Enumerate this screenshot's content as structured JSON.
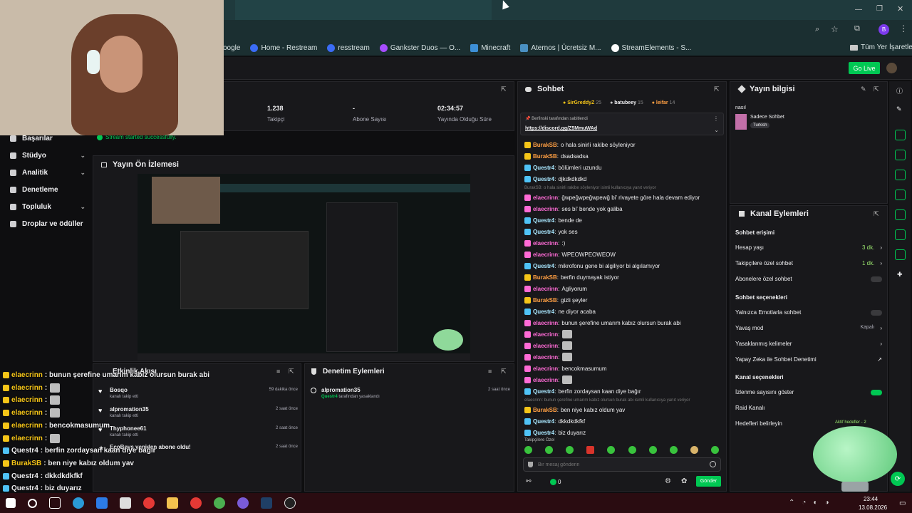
{
  "browser": {
    "bookmarks": [
      "oogle",
      "Home - Restream",
      "resstream",
      "Gankster Duos — O...",
      "Minecraft",
      "Aternos | Ücretsiz M...",
      "StreamElements - S..."
    ],
    "all_bookmarks": "Tüm Yer İşaretleri",
    "profile_initial": "B"
  },
  "header": {
    "go_live": "Go Live"
  },
  "stats": [
    {
      "value": "1.238",
      "label": "Takipçi"
    },
    {
      "value": "-",
      "label": "Abone Sayısı"
    },
    {
      "value": "02:34:57",
      "label": "Yayında Olduğu Süre"
    }
  ],
  "stream_status": "Stream started successfully.",
  "sidebar": {
    "items": [
      {
        "label": "Başarılar"
      },
      {
        "label": "Stüdyo"
      },
      {
        "label": "Analitik"
      },
      {
        "label": "Denetleme"
      },
      {
        "label": "Topluluk"
      },
      {
        "label": "Droplar ve ödüller"
      }
    ]
  },
  "preview": {
    "title": "Yayın Ön İzlemesi"
  },
  "activity": {
    "title": "Etkinlik Akışı",
    "items": [
      {
        "name": "Bosqo",
        "action": "kanalı takip etti",
        "time": "59 dakika önce"
      },
      {
        "name": "alpromation35",
        "action": "kanalı takip etti",
        "time": "2 saat önce"
      },
      {
        "name": "Thyphonee61",
        "action": "kanalı takip etti",
        "time": "2 saat önce"
      },
      {
        "name": "EcoBeys yeniden abone oldu!",
        "action": "",
        "time": "2 saat önce"
      }
    ]
  },
  "mod_actions": {
    "title": "Denetim Eylemleri",
    "items": [
      {
        "name": "alpromation35",
        "by": "Questr4",
        "action": "tarafından yasaklandı",
        "time": "2 saat önce"
      }
    ]
  },
  "chat": {
    "title": "Sohbet",
    "top_users": [
      {
        "name": "SirGreddyZ",
        "count": "25"
      },
      {
        "name": "batubeey",
        "count": "15"
      },
      {
        "name": "leifar",
        "count": "14"
      }
    ],
    "pinned_by": "Berfinski tarafından sabitlendi",
    "pinned_link": "https://discord.gg/Z5MmuWAd",
    "messages": [
      {
        "user": "BurakSB",
        "color": "o",
        "text": "o hala sinirli rakibe söyleniyor"
      },
      {
        "user": "BurakSB",
        "color": "o",
        "text": "dsadsadsa"
      },
      {
        "user": "Questr4",
        "color": "c",
        "text": "bölümleri uzundu"
      },
      {
        "user": "Questr4",
        "color": "c",
        "text": "djkdkdkdkd"
      },
      {
        "sys": "BurakSB: o hala sinirli rakibe söyleniyor isimli kullanıcıya yanıt veriyor"
      },
      {
        "user": "elaecrinn",
        "color": "p",
        "text": "ğwpeğwpeğwpewğ bi' rivayete göre hala devam ediyor"
      },
      {
        "user": "elaecrinn",
        "color": "p",
        "text": "ses bi' bende yok galiba"
      },
      {
        "user": "Questr4",
        "color": "c",
        "text": "bende de"
      },
      {
        "user": "Questr4",
        "color": "c",
        "text": "yok ses"
      },
      {
        "user": "elaecrinn",
        "color": "p",
        "text": ":)"
      },
      {
        "user": "elaecrinn",
        "color": "p",
        "text": "WPEOWPEOWEOW"
      },
      {
        "user": "Questr4",
        "color": "c",
        "text": "mikrofonu gene bi algiliyor bi algılamıyor"
      },
      {
        "user": "BurakSB",
        "color": "o",
        "text": "berfin duymayak istiyor"
      },
      {
        "user": "elaecrinn",
        "color": "p",
        "text": "Agliyorum"
      },
      {
        "user": "BurakSB",
        "color": "o",
        "text": "gizli şeyler"
      },
      {
        "user": "Questr4",
        "color": "c",
        "text": "ne diyor acaba"
      },
      {
        "user": "elaecrinn",
        "color": "p",
        "text": "bunun şerefine umarım kabız olursun burak abi"
      },
      {
        "user": "elaecrinn",
        "color": "p",
        "text": "",
        "emote": true
      },
      {
        "user": "elaecrinn",
        "color": "p",
        "text": "",
        "emote": true
      },
      {
        "user": "elaecrinn",
        "color": "p",
        "text": "",
        "emote": true
      },
      {
        "user": "elaecrinn",
        "color": "p",
        "text": "bencokmasumum"
      },
      {
        "user": "elaecrinn",
        "color": "p",
        "text": "",
        "emote": true
      },
      {
        "user": "Questr4",
        "color": "c",
        "text": "berfin zordaysan kaan diye bağır"
      },
      {
        "sys": "elaecrinn: bunun şerefine umarım kabız olursun burak abi isimli kullanıcıya yanıt veriyor"
      },
      {
        "user": "BurakSB",
        "color": "o",
        "text": "ben niye kabız oldum yav"
      },
      {
        "user": "Questr4",
        "color": "c",
        "text": "dkkdkdkfkf"
      },
      {
        "user": "Questr4",
        "color": "c",
        "text": "biz duyarız"
      }
    ],
    "followers_only": "Takipçilere Özel",
    "input_placeholder": "Bir mesaj gönderin",
    "points": "0",
    "send": "Gönder"
  },
  "stream_info": {
    "title": "Yayın bilgisi",
    "stream_title": "nasıl",
    "category": "Sadece Sohbet",
    "tag": "Turkish"
  },
  "channel_actions": {
    "title": "Kanal Eylemleri",
    "chat_access": "Sohbet erişimi",
    "account_age": "Hesap yaşı",
    "account_age_val": "3 dk.",
    "followers_chat": "Takipçilere özel sohbet",
    "followers_chat_val": "1 dk.",
    "subs_chat": "Abonelere özel sohbet",
    "chat_options": "Sohbet seçenekleri",
    "emote_only": "Yalnızca Emotlarla sohbet",
    "slow_mode": "Yavaş mod",
    "slow_mode_val": "Kapalı",
    "blocked_terms": "Yasaklanmış kelimeler",
    "ai_mod": "Yapay Zeka ile Sohbet Denetimi",
    "channel_options": "Kanal seçenekleri",
    "show_viewers": "İzlenme sayısını göster",
    "raid": "Raid Kanalı",
    "goals": "Hedefleri belirleyin",
    "active_goals": "Aktif hedefler - 2"
  },
  "overlay_chat": [
    {
      "user": "elaecrinn",
      "text": ": bunun şerefine umarım kabız olursun burak abi"
    },
    {
      "user": "elaecrinn",
      "text": ":",
      "emote": true
    },
    {
      "user": "elaecrinn",
      "text": ":",
      "emote": true
    },
    {
      "user": "elaecrinn",
      "text": ":",
      "emote": true
    },
    {
      "user": "elaecrinn",
      "text": ": bencokmasumum"
    },
    {
      "user": "elaecrinn",
      "text": ":",
      "emote": true
    },
    {
      "user": "Questr4",
      "text": ": berfin zordaysan kaan diye bağır"
    },
    {
      "user": "BurakSB",
      "text": ": ben niye kabız oldum yav"
    },
    {
      "user": "Questr4",
      "text": ": dkkdkdkfkf"
    },
    {
      "user": "Questr4",
      "text": ": biz duyarız"
    }
  ],
  "taskbar": {
    "time": "23:44",
    "date": "13.08.2026"
  }
}
